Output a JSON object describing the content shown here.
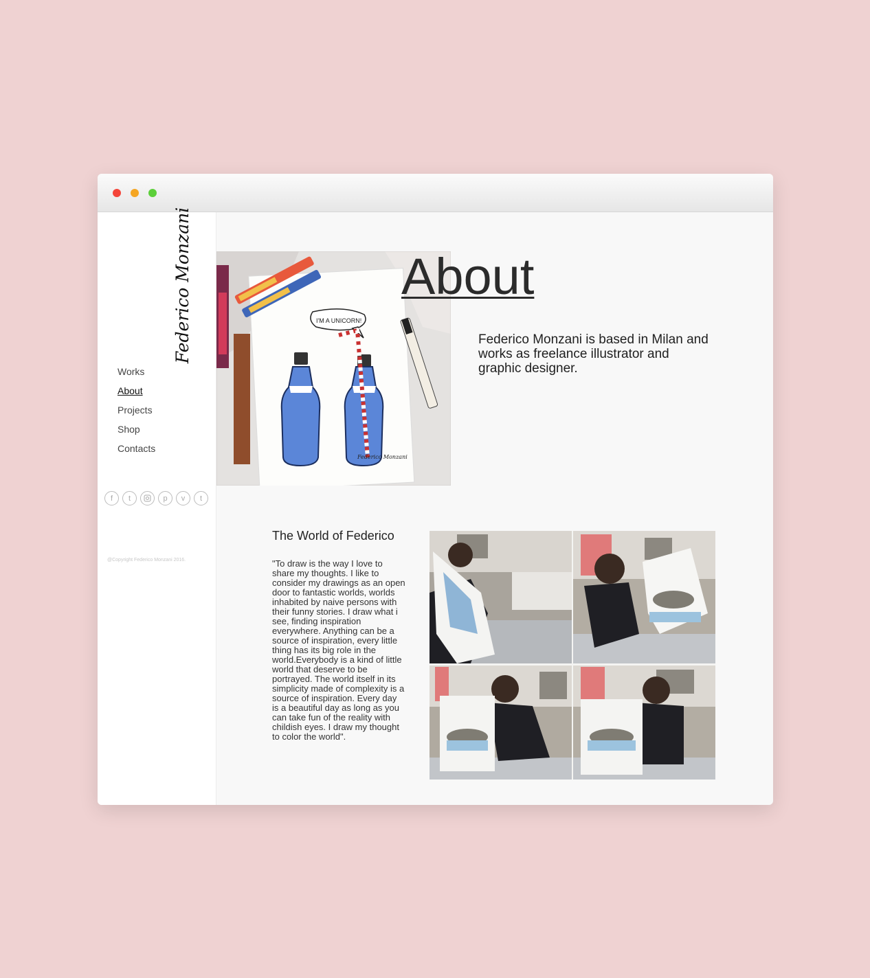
{
  "window": {
    "controls": [
      "close",
      "minimize",
      "zoom"
    ]
  },
  "sidebar": {
    "logo_text": "Federico Monzani",
    "nav": [
      {
        "label": "Works",
        "active": false
      },
      {
        "label": "About",
        "active": true
      },
      {
        "label": "Projects",
        "active": false
      },
      {
        "label": "Shop",
        "active": false
      },
      {
        "label": "Contacts",
        "active": false
      }
    ],
    "social": [
      "facebook-icon",
      "twitter-icon",
      "instagram-icon",
      "pinterest-icon",
      "vimeo-icon",
      "tumblr-icon"
    ],
    "copyright": "@Copyright Federico Monzani 2016."
  },
  "main": {
    "title": "About",
    "intro": "Federico Monzani is based in Milan and works as freelance illustrator and graphic designer.",
    "hero_image": {
      "speech_bubble": "I'M A UNICORN!",
      "signature": "Federico Monzani"
    },
    "world": {
      "heading": "The World of Federico",
      "quote": "\"To draw is the way I love to share my thoughts. I like to consider my drawings as an open door to fantastic worlds, worlds inhabited by naive persons with their funny stories. I draw what i see, finding inspiration everywhere. Anything can be a source of inspiration, every little thing has its big role in the world.Everybody is a kind of little world that deserve to be portrayed. The world itself in its simplicity made of complexity is a source of inspiration. Every day is a beautiful day as long as you can take fun of the reality with childish eyes. I draw my thought to color the world\"."
    }
  },
  "colors": {
    "background": "#efd2d2",
    "page": "#f8f8f8",
    "text": "#2b2b2b",
    "close": "#f4453a",
    "minimize": "#f5a623",
    "zoom": "#5ccf3a"
  }
}
